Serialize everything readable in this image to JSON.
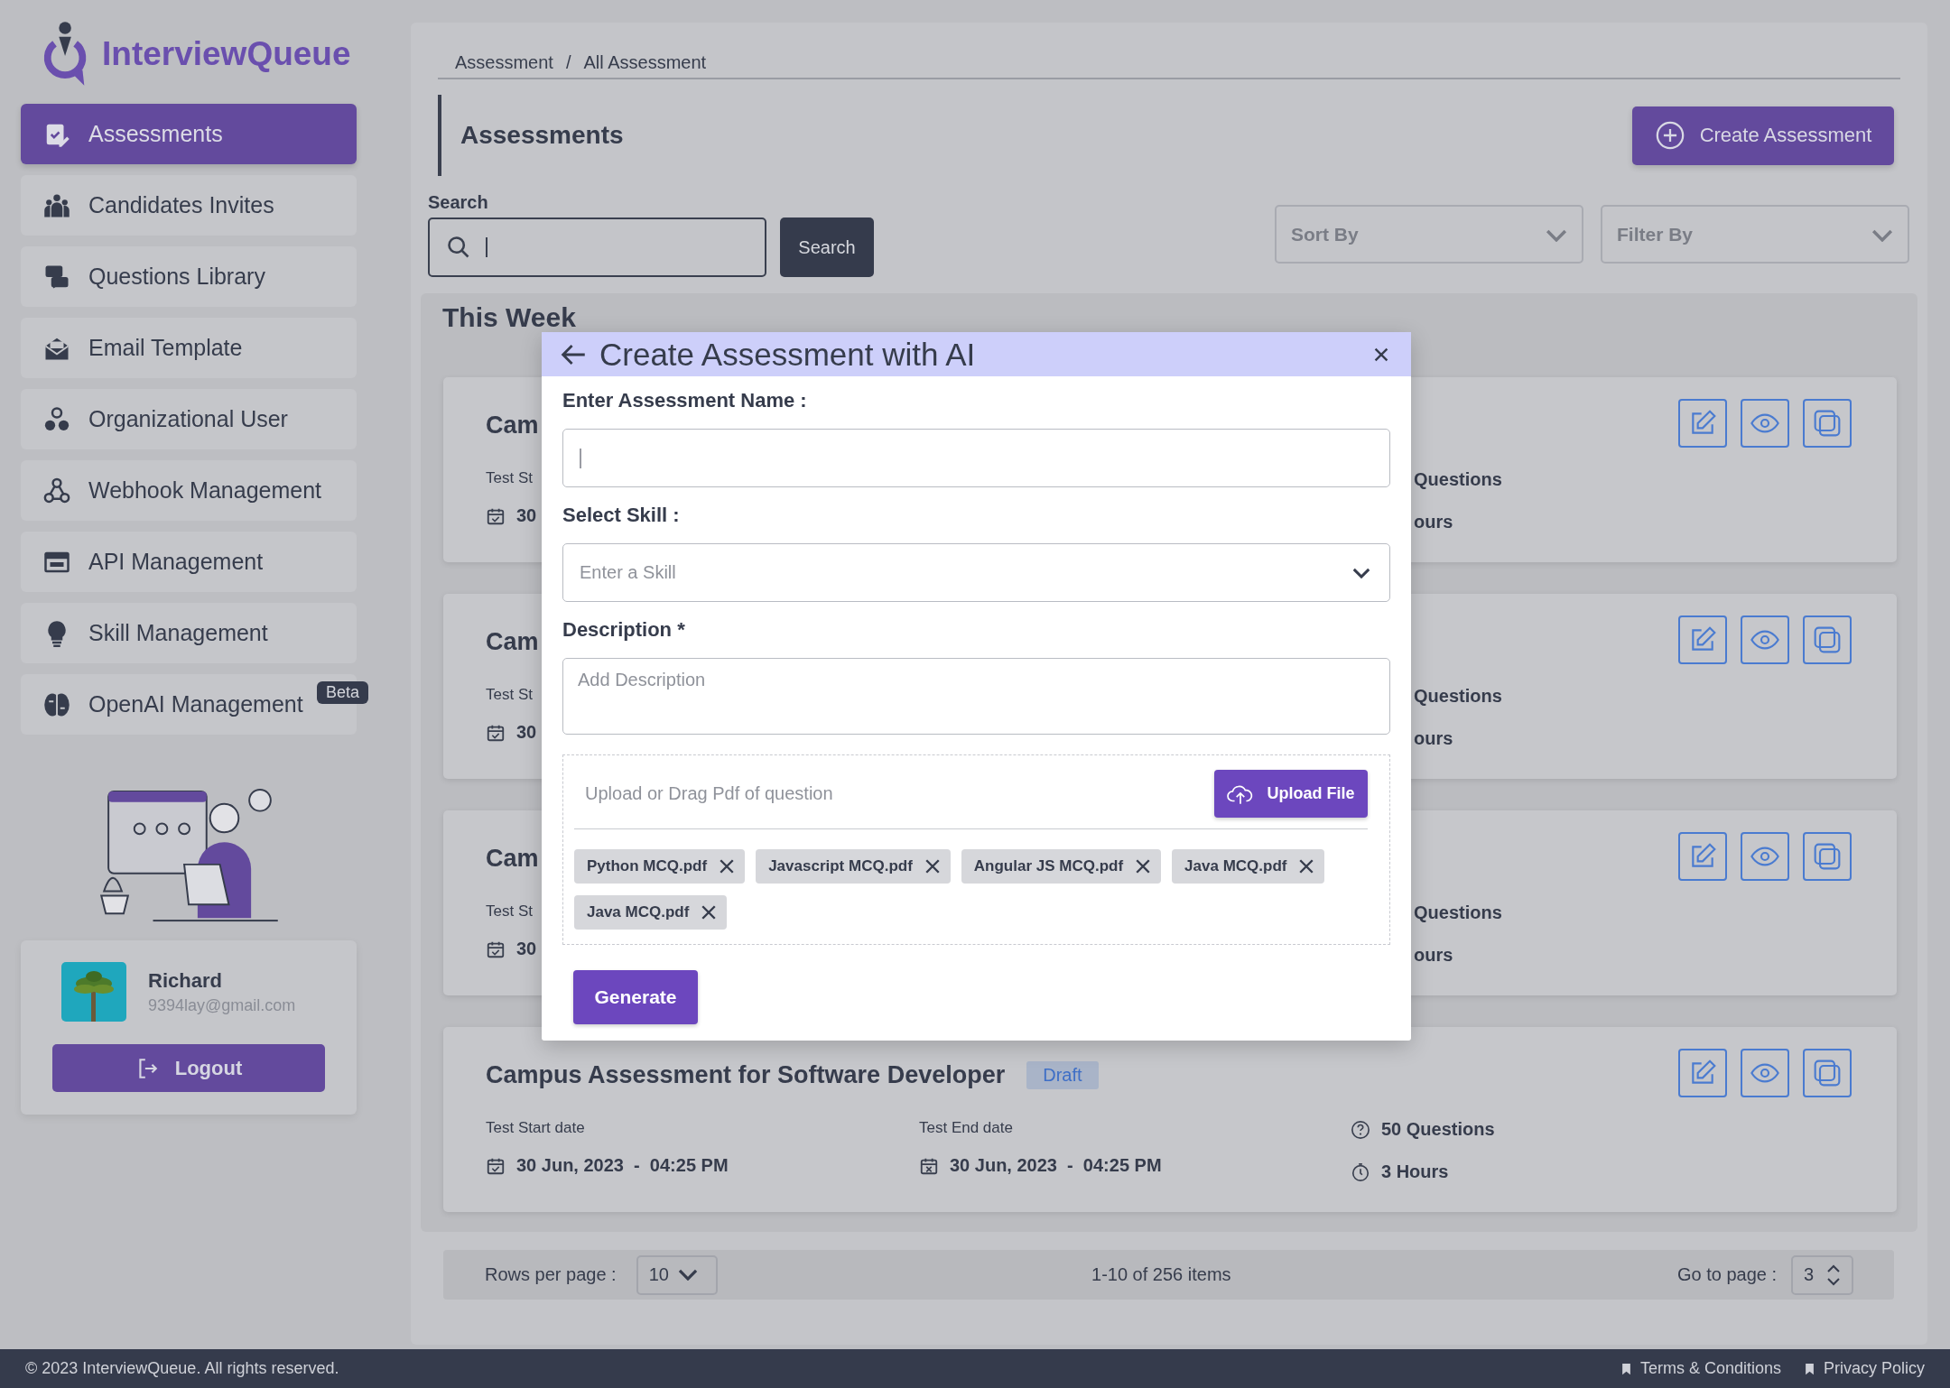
{
  "brand": {
    "name": "InterviewQueue"
  },
  "sidebar": {
    "items": [
      {
        "label": "Assessments",
        "selected": true
      },
      {
        "label": "Candidates Invites",
        "selected": false
      },
      {
        "label": "Questions Library",
        "selected": false
      },
      {
        "label": "Email Template",
        "selected": false
      },
      {
        "label": "Organizational User",
        "selected": false
      },
      {
        "label": "Webhook Management",
        "selected": false
      },
      {
        "label": "API Management",
        "selected": false
      },
      {
        "label": "Skill Management",
        "selected": false
      },
      {
        "label": "OpenAI Management",
        "badge": "Beta",
        "selected": false
      }
    ]
  },
  "user": {
    "name": "Richard",
    "email": "9394lay@gmail.com",
    "logout": "Logout"
  },
  "breadcrumb": {
    "parent": "Assessment",
    "separator": "/",
    "current": "All Assessment"
  },
  "page_title": "Assessments",
  "create_button": "Create Assessment",
  "search": {
    "label": "Search",
    "button": "Search"
  },
  "sort": {
    "placeholder": "Sort By"
  },
  "filter": {
    "placeholder": "Filter By"
  },
  "section": {
    "title": "This Week"
  },
  "assessments": [
    {
      "title": "Cam",
      "start_label": "Test St",
      "start_value": "30",
      "questions": "Questions",
      "duration": "ours"
    },
    {
      "title": "Cam",
      "start_label": "Test St",
      "start_value": "30",
      "questions": "Questions",
      "duration": "ours"
    },
    {
      "title": "Cam",
      "start_label": "Test St",
      "start_value": "30",
      "questions": "Questions",
      "duration": "ours"
    },
    {
      "title": "Campus Assessment for Software Developer",
      "status": "Draft",
      "start_label": "Test Start date",
      "start_value": "30 Jun, 2023  -  04:25 PM",
      "end_label": "Test End date",
      "end_value": "30 Jun, 2023  -  04:25 PM",
      "questions": "50 Questions",
      "duration": "3 Hours"
    }
  ],
  "pagination": {
    "rows_label": "Rows per page :",
    "rows_value": "10",
    "summary": "1-10 of 256 items",
    "goto_label": "Go to page :",
    "page_value": "3"
  },
  "modal": {
    "title": "Create Assessment with AI",
    "name_label": "Enter Assessment Name :",
    "skill_label": "Select Skill :",
    "skill": {
      "placeholder": "Enter a Skill"
    },
    "description_label": "Description *",
    "description": {
      "placeholder": "Add Description"
    },
    "upload_hint": "Upload or Drag Pdf of question",
    "upload_button": "Upload File",
    "files": [
      "Python MCQ.pdf",
      "Javascript MCQ.pdf",
      "Angular JS MCQ.pdf",
      "Java MCQ.pdf",
      "Java MCQ.pdf"
    ],
    "generate_button": "Generate"
  },
  "footer": {
    "copyright": "© 2023 InterviewQueue. All rights reserved.",
    "links": [
      "Terms & Conditions",
      "Privacy Policy"
    ]
  }
}
